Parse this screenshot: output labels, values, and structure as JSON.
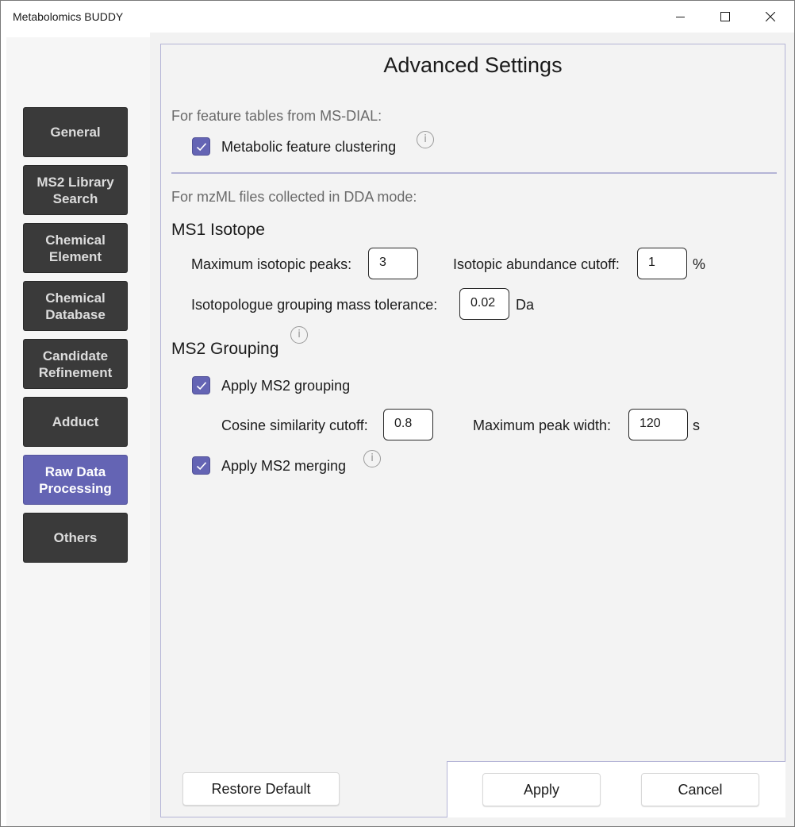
{
  "window": {
    "title": "Metabolomics BUDDY",
    "controls": {
      "minimize_icon": "minimize-icon",
      "maximize_icon": "maximize-icon",
      "close_icon": "close-icon"
    }
  },
  "sidebar": {
    "items": [
      {
        "label": "General",
        "active": false
      },
      {
        "label": "MS2 Library\nSearch",
        "active": false
      },
      {
        "label": "Chemical\nElement",
        "active": false
      },
      {
        "label": "Chemical\nDatabase",
        "active": false
      },
      {
        "label": "Candidate\nRefinement",
        "active": false
      },
      {
        "label": "Adduct",
        "active": false
      },
      {
        "label": "Raw Data\nProcessing",
        "active": true
      },
      {
        "label": "Others",
        "active": false
      }
    ],
    "colors": {
      "item_bg": "#3a3a3a",
      "active_bg": "#6464b4"
    }
  },
  "main": {
    "heading": "Advanced Settings",
    "msdial": {
      "note": "For feature tables from MS-DIAL:",
      "clustering_label": "Metabolic feature clustering",
      "clustering_checked": true
    },
    "dda": {
      "note": "For mzML files collected in DDA mode:"
    },
    "ms1": {
      "title": "MS1 Isotope",
      "max_peaks_label": "Maximum isotopic peaks:",
      "max_peaks_value": "3",
      "abundance_cutoff_label": "Isotopic abundance cutoff:",
      "abundance_cutoff_value": "1",
      "abundance_unit": "%",
      "mass_tol_label": "Isotopologue grouping mass tolerance:",
      "mass_tol_value": "0.02",
      "mass_tol_unit": "Da"
    },
    "ms2": {
      "title": "MS2 Grouping",
      "apply_grouping_label": "Apply MS2 grouping",
      "apply_grouping_checked": true,
      "cosine_label": "Cosine similarity cutoff:",
      "cosine_value": "0.8",
      "peak_width_label": "Maximum peak width:",
      "peak_width_value": "120",
      "peak_width_unit": "s",
      "apply_merging_label": "Apply MS2 merging",
      "apply_merging_checked": true
    },
    "info_glyph": "i"
  },
  "footer": {
    "restore_label": "Restore Default",
    "apply_label": "Apply",
    "cancel_label": "Cancel"
  },
  "colors": {
    "accent": "#6464b4",
    "panel_border": "#b4b4d6"
  }
}
